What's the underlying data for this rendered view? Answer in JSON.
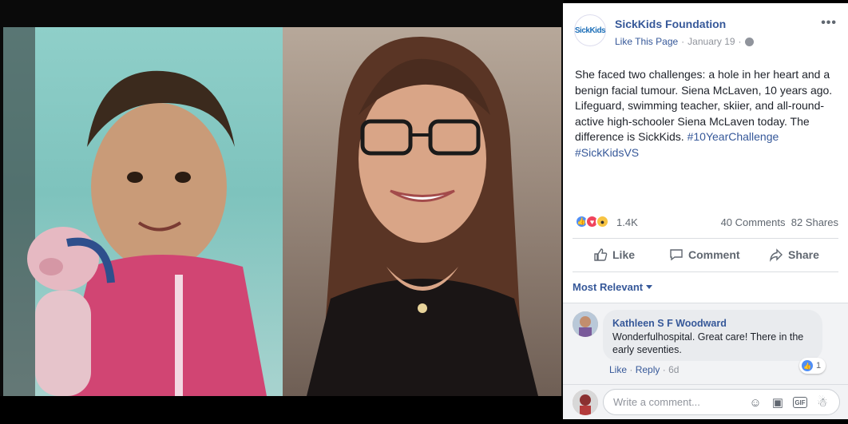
{
  "post": {
    "page_name": "SickKids Foundation",
    "avatar_text": "SickKids",
    "like_page": "Like This Page",
    "separator": "·",
    "date": "January 19",
    "more": "•••",
    "text": "She faced two challenges: a hole in her heart and a benign facial tumour. Siena McLaven, 10 years ago. Lifeguard, swimming teacher, skiier, and all-round-active high-schooler Siena McLaven today. The difference is SickKids. ",
    "hashtag1": "#10YearChallenge",
    "hashtag2": "#SickKidsVS"
  },
  "reactions": {
    "count": "1.4K",
    "comments": "40 Comments",
    "shares": "82 Shares"
  },
  "actions": {
    "like": "Like",
    "comment": "Comment",
    "share": "Share"
  },
  "sort": {
    "label": "Most Relevant"
  },
  "comment": {
    "author": "Kathleen S F Woodward",
    "text": "Wonderfulhospital. Great care! There in the early seventies.",
    "reaction_count": "1",
    "like": "Like",
    "reply": "Reply",
    "dot": "·",
    "time": "6d"
  },
  "composer": {
    "placeholder": "Write a comment..."
  },
  "colors": {
    "link": "#365899",
    "like_blue": "#4f8ef6",
    "love_red": "#f0435d",
    "wow_yellow": "#f7c443"
  }
}
